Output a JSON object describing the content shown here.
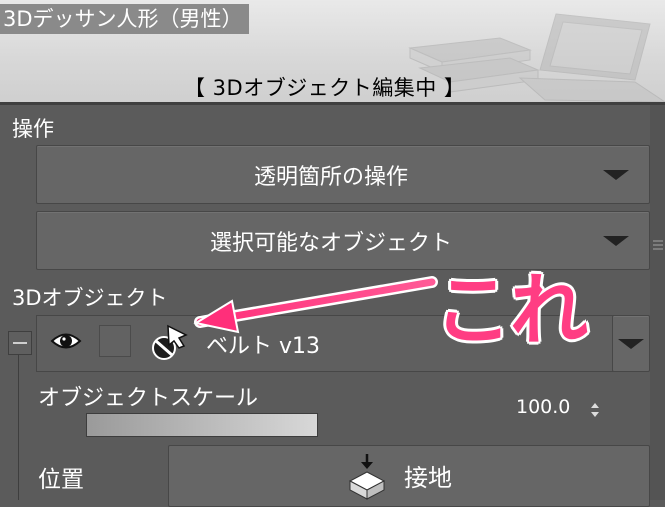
{
  "header": {
    "title": "3Dデッサン人形（男性）",
    "status": "【 3Dオブジェクト編集中 】"
  },
  "operation": {
    "label": "操作",
    "transparent_dropdown": "透明箇所の操作",
    "selectable_dropdown": "選択可能なオブジェクト"
  },
  "object3d": {
    "label": "3Dオブジェクト",
    "current_object": "ベルト v13"
  },
  "scale": {
    "label": "オブジェクトスケール",
    "value": "100.0",
    "fill_fraction": 1.0
  },
  "position": {
    "label": "位置",
    "ground_button": "接地"
  },
  "annotation": {
    "text": "これ",
    "color": "#ff3d83"
  },
  "icons": [
    "eye-icon",
    "lock-toggle",
    "object-select-cursor-icon",
    "dropdown-arrow-icon",
    "spinner-icon",
    "ground-icon"
  ]
}
